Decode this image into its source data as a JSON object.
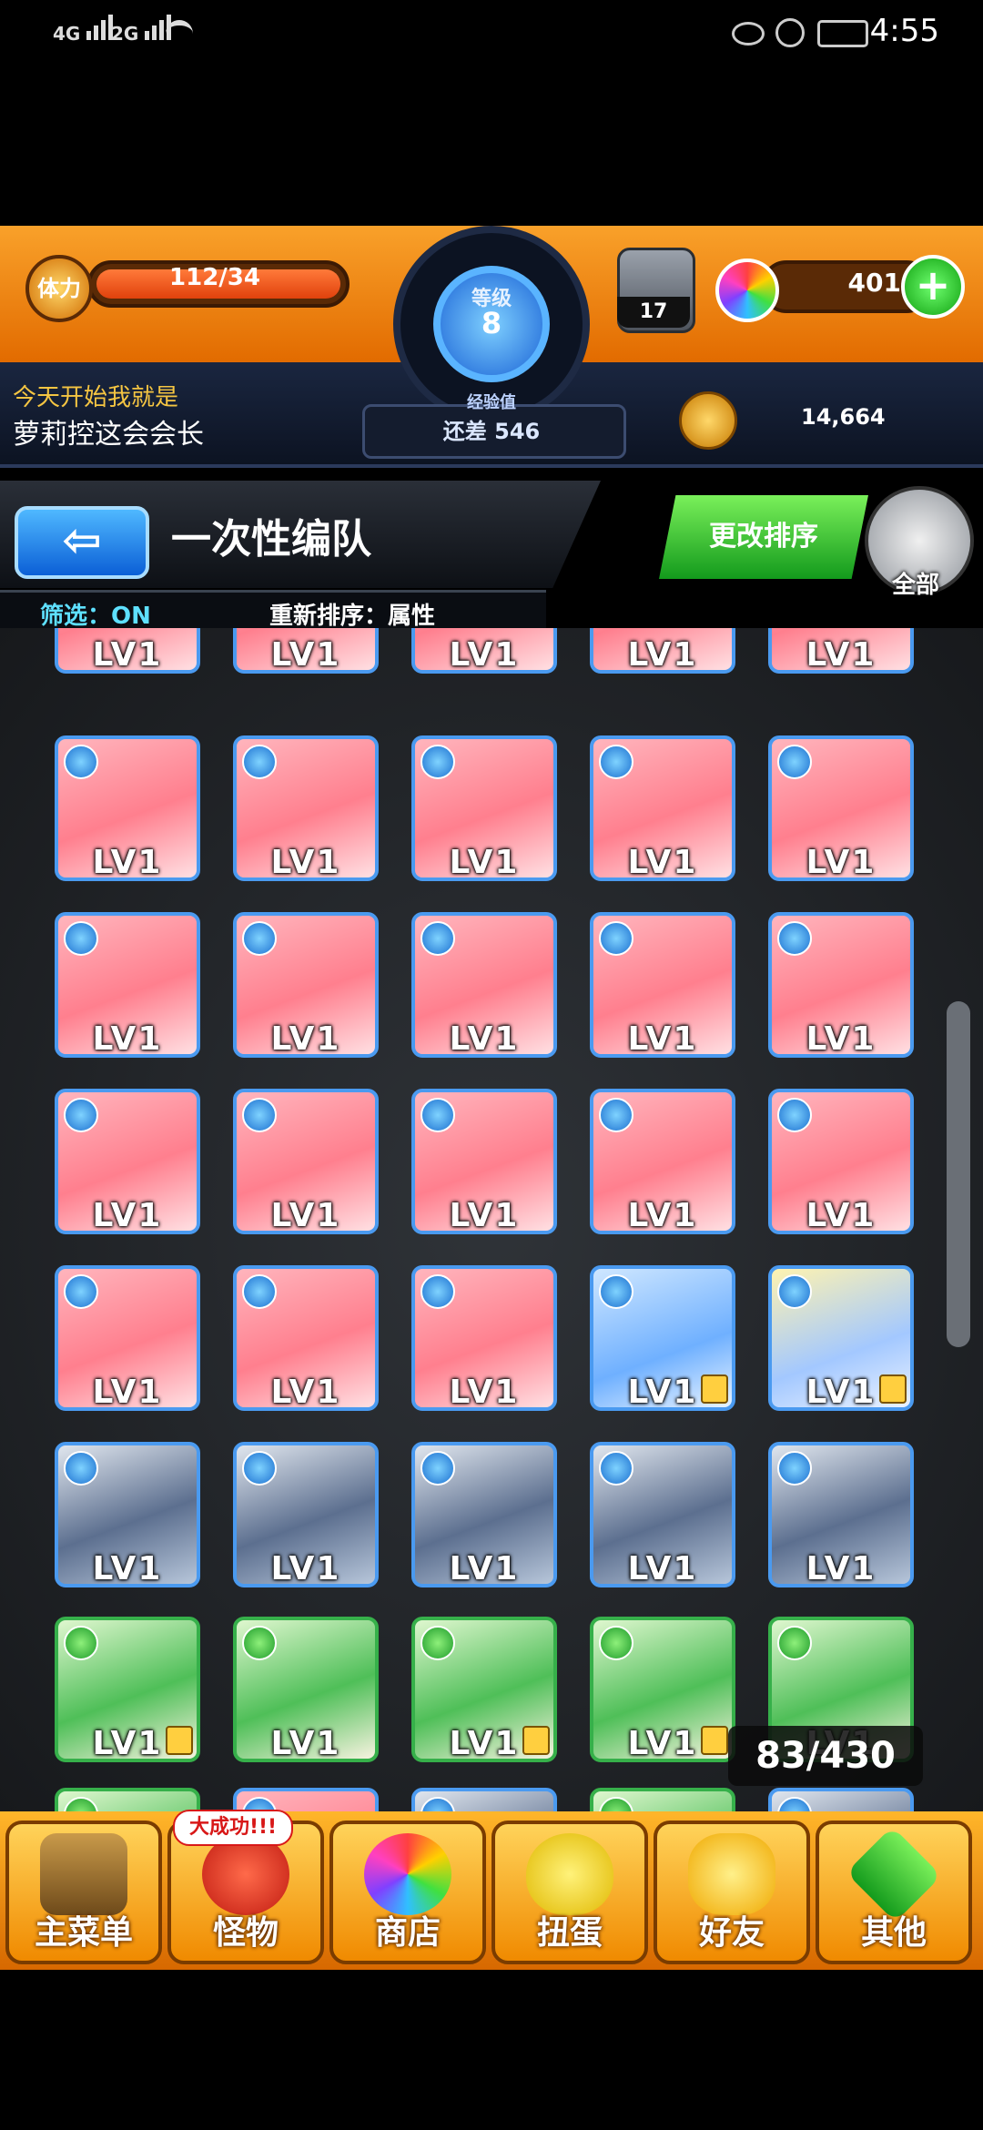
{
  "status_bar": {
    "signal_1": "4G",
    "signal_2": "2G",
    "time": "4:55"
  },
  "header": {
    "stamina_label": "体力",
    "stamina_value": "112/34",
    "level_label": "等级",
    "level_value": "8",
    "exp_label": "经验值",
    "exp_value": "还差 546",
    "orb_stock": "17",
    "gems": "401",
    "motto_line1": "今天开始我就是",
    "motto_line2": "萝莉控这会会长",
    "coins": "14,664"
  },
  "toolbar": {
    "title": "一次性编队",
    "filter": "筛选：ON",
    "sort": "重新排序：属性",
    "change_order": "更改排序",
    "all_label": "全部"
  },
  "grid": {
    "level_label": "LV1",
    "count": "83/430"
  },
  "bottom_nav": {
    "promo_badge": "大成功!!!",
    "items": [
      {
        "label": "主菜单"
      },
      {
        "label": "怪物"
      },
      {
        "label": "商店"
      },
      {
        "label": "扭蛋"
      },
      {
        "label": "好友"
      },
      {
        "label": "其他"
      }
    ]
  },
  "colors": {
    "accent_orange": "#f08a00",
    "accent_blue": "#1b6fd0",
    "accent_green": "#139a1c"
  },
  "icons": [
    "back-arrow-icon",
    "refresh-icon",
    "plus-icon",
    "gem-icon",
    "coin-icon",
    "lock-icon"
  ]
}
